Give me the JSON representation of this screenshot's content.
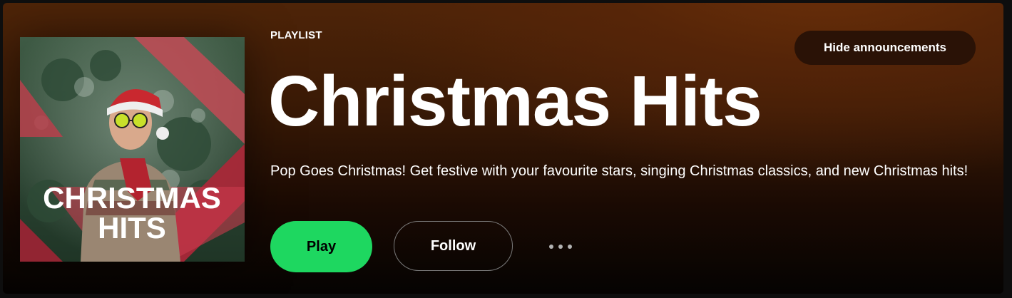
{
  "header": {
    "type_label": "PLAYLIST",
    "title": "Christmas Hits",
    "description": "Pop Goes Christmas! Get festive with your favourite stars, singing Christmas classics, and new Christmas hits!"
  },
  "cover": {
    "text_line1": "CHRISTMAS",
    "text_line2": "HITS"
  },
  "actions": {
    "play_label": "Play",
    "follow_label": "Follow",
    "more_icon": "more-horizontal-icon",
    "hide_announcements_label": "Hide announcements"
  },
  "colors": {
    "accent": "#1ed760",
    "banner_top": "#4e2408",
    "banner_bottom": "#050302"
  }
}
